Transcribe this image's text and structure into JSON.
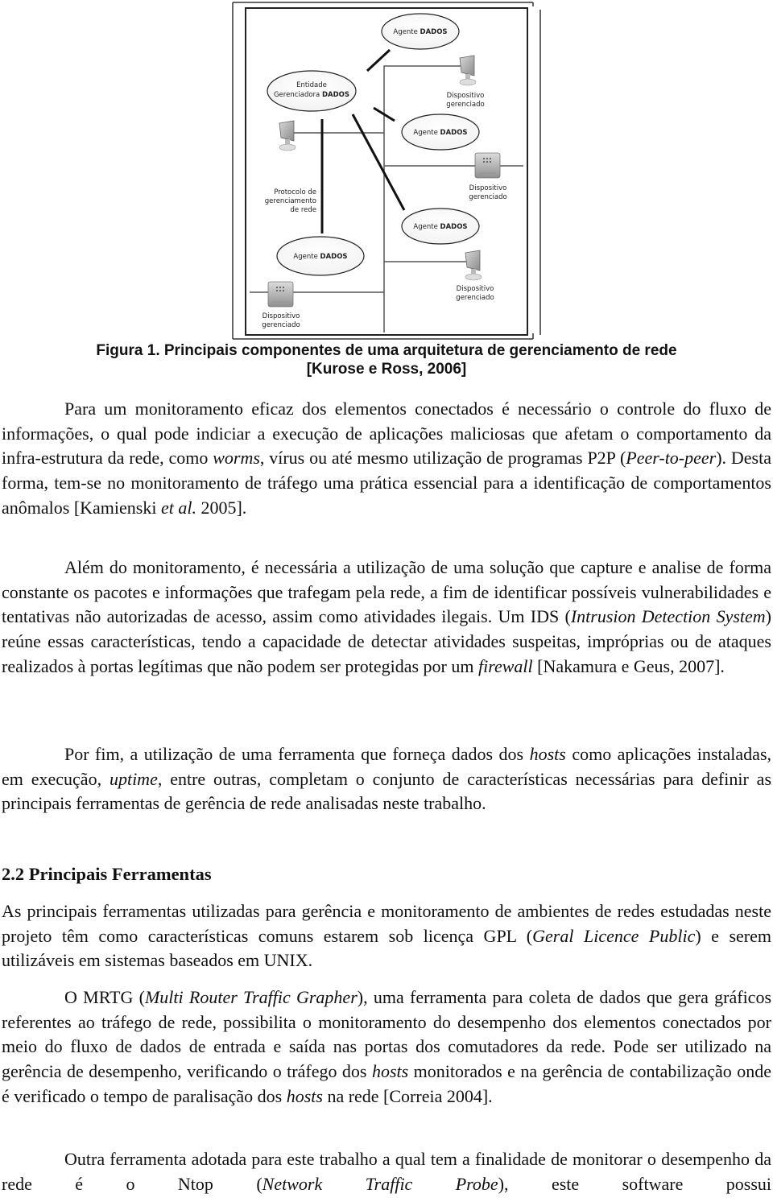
{
  "figure": {
    "diagram": {
      "nodes": {
        "agent_top": {
          "label_regular": "Agente ",
          "label_bold": "DADOS"
        },
        "manager": {
          "line1": "Entidade",
          "line2_regular": "Gerenciadora ",
          "line2_bold": "DADOS"
        },
        "agent_mid": {
          "label_regular": "Agente ",
          "label_bold": "DADOS"
        },
        "agent_right_lower": {
          "label_regular": "Agente ",
          "label_bold": "DADOS"
        },
        "agent_left_lower": {
          "label_regular": "Agente ",
          "label_bold": "DADOS"
        }
      },
      "devices": [
        {
          "icon": "monitor-icon",
          "line1": "Dispositivo",
          "line2": "gerenciado"
        },
        {
          "icon": "router-icon",
          "line1": "Dispositivo",
          "line2": "gerenciado"
        },
        {
          "icon": "monitor-icon",
          "line1": "Dispositivo",
          "line2": "gerenciado"
        },
        {
          "icon": "router-icon",
          "line1": "Dispositivo",
          "line2": "gerenciado"
        }
      ],
      "unlabeled_device_icon": "monitor-icon",
      "protocol_label": [
        "Protocolo de",
        "gerenciamento",
        "de rede"
      ]
    },
    "caption_line1": "Figura 1. Principais componentes de uma arquitetura de gerenciamento de rede",
    "caption_line2": "[Kurose e Ross, 2006]"
  },
  "paragraphs": {
    "p1": {
      "a": "Para um monitoramento eficaz dos elementos conectados é necessário o controle do fluxo de informações, o qual pode indiciar a execução de aplicações maliciosas que afetam o comportamento da infra-estrutura da rede, como ",
      "b_italic": "worms",
      "c": ", vírus ou até mesmo utilização de programas P2P (",
      "d_italic": "Peer-to-peer",
      "e": "). Desta forma, tem-se no monitoramento de tráfego uma prática essencial para a identificação de comportamentos anômalos [Kamienski ",
      "f_italic": "et al.",
      "g": " 2005]."
    },
    "p2": {
      "a": "Além do monitoramento, é necessária a utilização de uma solução que capture e analise de forma constante os pacotes e informações que trafegam pela rede, a fim de identificar possíveis vulnerabilidades e tentativas não autorizadas de acesso, assim como atividades ilegais. Um IDS (",
      "b_italic": "Intrusion Detection System",
      "c": ") reúne essas características, tendo a capacidade de detectar atividades suspeitas, impróprias ou de ataques realizados à portas legítimas que não podem ser protegidas por um ",
      "d_italic": "firewall",
      "e": " [Nakamura e Geus, 2007]."
    },
    "p3": {
      "a": "Por fim, a utilização de uma ferramenta que forneça dados dos ",
      "b_italic": "hosts",
      "c": " como aplicações instaladas, em execução, ",
      "d_italic": "uptime",
      "e": ", entre outras, completam o conjunto de características necessárias para definir as principais ferramentas de gerência de rede analisadas neste trabalho."
    },
    "section_heading": "2.2 Principais Ferramentas",
    "p4": {
      "a": "As principais ferramentas utilizadas para gerência e monitoramento de ambientes de redes estudadas neste projeto têm como características comuns estarem sob licença GPL (",
      "b_italic": "Geral Licence Public",
      "c": ") e serem utilizáveis em sistemas baseados em UNIX."
    },
    "p5": {
      "a": "O MRTG (",
      "b_italic": "Multi Router Traffic Grapher",
      "c": "), uma ferramenta para coleta de dados que gera gráficos referentes ao tráfego de rede, possibilita o monitoramento do desempenho dos elementos conectados por meio do fluxo de dados de entrada e saída nas portas dos comutadores da rede. Pode ser utilizado na gerência de desempenho, verificando o tráfego dos ",
      "d_italic": "hosts",
      "e": " monitorados e na gerência de contabilização onde é verificado o tempo de paralisação dos ",
      "f_italic": "hosts",
      "g": " na rede [Correia 2004]."
    },
    "p6": {
      "a": "Outra ferramenta adotada para este trabalho a qual tem a finalidade de monitorar o desempenho da rede é o Ntop (",
      "b_italic": "Network Traffic Probe",
      "c": "), este software possui"
    }
  }
}
